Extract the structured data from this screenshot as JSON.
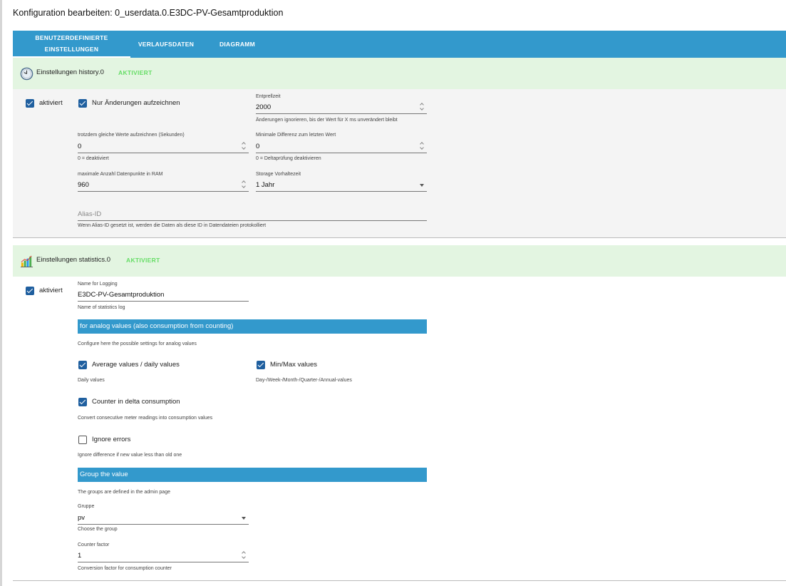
{
  "dialog": {
    "title": "Konfiguration bearbeiten: 0_userdata.0.E3DC-PV-Gesamtproduktion"
  },
  "tabs": [
    {
      "label_line1": "BENUTZERDEFINIERTE",
      "label_line2": "EINSTELLUNGEN",
      "active": true
    },
    {
      "label": "VERLAUFSDATEN",
      "active": false
    },
    {
      "label": "DIAGRAMM",
      "active": false
    }
  ],
  "colors": {
    "accent": "#3399cc",
    "header_bg": "#e3f5e1",
    "status": "#66dd66",
    "checkbox": "#1f5f9f"
  },
  "history": {
    "icon": "clock-icon",
    "title": "Einstellungen history.0",
    "status": "AKTIVIERT",
    "enabled_label": "aktiviert",
    "changes_only_label": "Nur Änderungen aufzeichnen",
    "debounce_label": "Entprellzeit",
    "debounce_value": "2000",
    "debounce_hint": "Änderungen ignorieren, bis der Wert für X ms unverändert bleibt",
    "same_values_label": "trotzdem gleiche Werte aufzeichnen (Sekunden)",
    "same_values_value": "0",
    "same_values_hint": "0 = deaktiviert",
    "min_diff_label": "Minimale Differenz zum letzten Wert",
    "min_diff_value": "0",
    "min_diff_hint": "0 = Deltaprüfung deaktivieren",
    "max_points_label": "maximale Anzahl Datenpunkte in RAM",
    "max_points_value": "960",
    "retention_label": "Storage Vorhaltezeit",
    "retention_value": "1 Jahr",
    "alias_placeholder": "Alias-ID",
    "alias_hint": "Wenn Alias-ID gesetzt ist, werden die Daten als diese ID in Datendateien protokolliert"
  },
  "statistics": {
    "icon": "bar-chart-icon",
    "title": "Einstellungen statistics.0",
    "status": "AKTIVIERT",
    "enabled_label": "aktiviert",
    "name_label": "Name for Logging",
    "name_value": "E3DC-PV-Gesamtproduktion",
    "name_hint": "Name of statistics log",
    "analog_band": "for analog values (also consumption from counting)",
    "analog_hint": "Configure here the possible settings for analog values",
    "avg_label": "Average values / daily values",
    "avg_hint": "Daily values",
    "minmax_label": "Min/Max values",
    "minmax_hint": "Day-/Week-/Month-/Quarter-/Annual-values",
    "counter_label": "Counter in delta consumption",
    "counter_hint": "Convert consecutive meter readings into consumption values",
    "ignore_label": "Ignore errors",
    "ignore_hint": "Ignore difference if new value less than old one",
    "group_band": "Group the value",
    "group_band_hint": "The groups are defined in the admin page",
    "group_label": "Gruppe",
    "group_value": "pv",
    "group_hint": "Choose the group",
    "factor_label": "Counter factor",
    "factor_value": "1",
    "factor_hint": "Conversion factor for consumption counter"
  }
}
